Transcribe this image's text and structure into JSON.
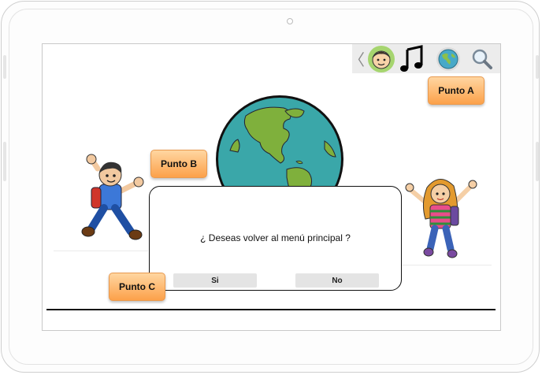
{
  "toolbar": {
    "back_icon": "chevron-left-icon",
    "items": [
      {
        "name": "face-icon",
        "icon": "boy-face"
      },
      {
        "name": "music-icon",
        "icon": "music-note"
      },
      {
        "name": "globe-icon",
        "icon": "globe"
      },
      {
        "name": "search-icon",
        "icon": "magnifier"
      }
    ],
    "back_glyph": "〈"
  },
  "buttons": {
    "punto_a": "Punto A",
    "punto_b": "Punto B",
    "punto_c": "Punto C"
  },
  "dialog": {
    "message": "¿ Deseas volver al menú principal ?",
    "yes_label": "Si",
    "no_label": "No"
  },
  "colors": {
    "button_top": "#ffd6a1",
    "button_bottom": "#fca14a",
    "ocean": "#3aa7a9",
    "land": "#7fb03c"
  }
}
